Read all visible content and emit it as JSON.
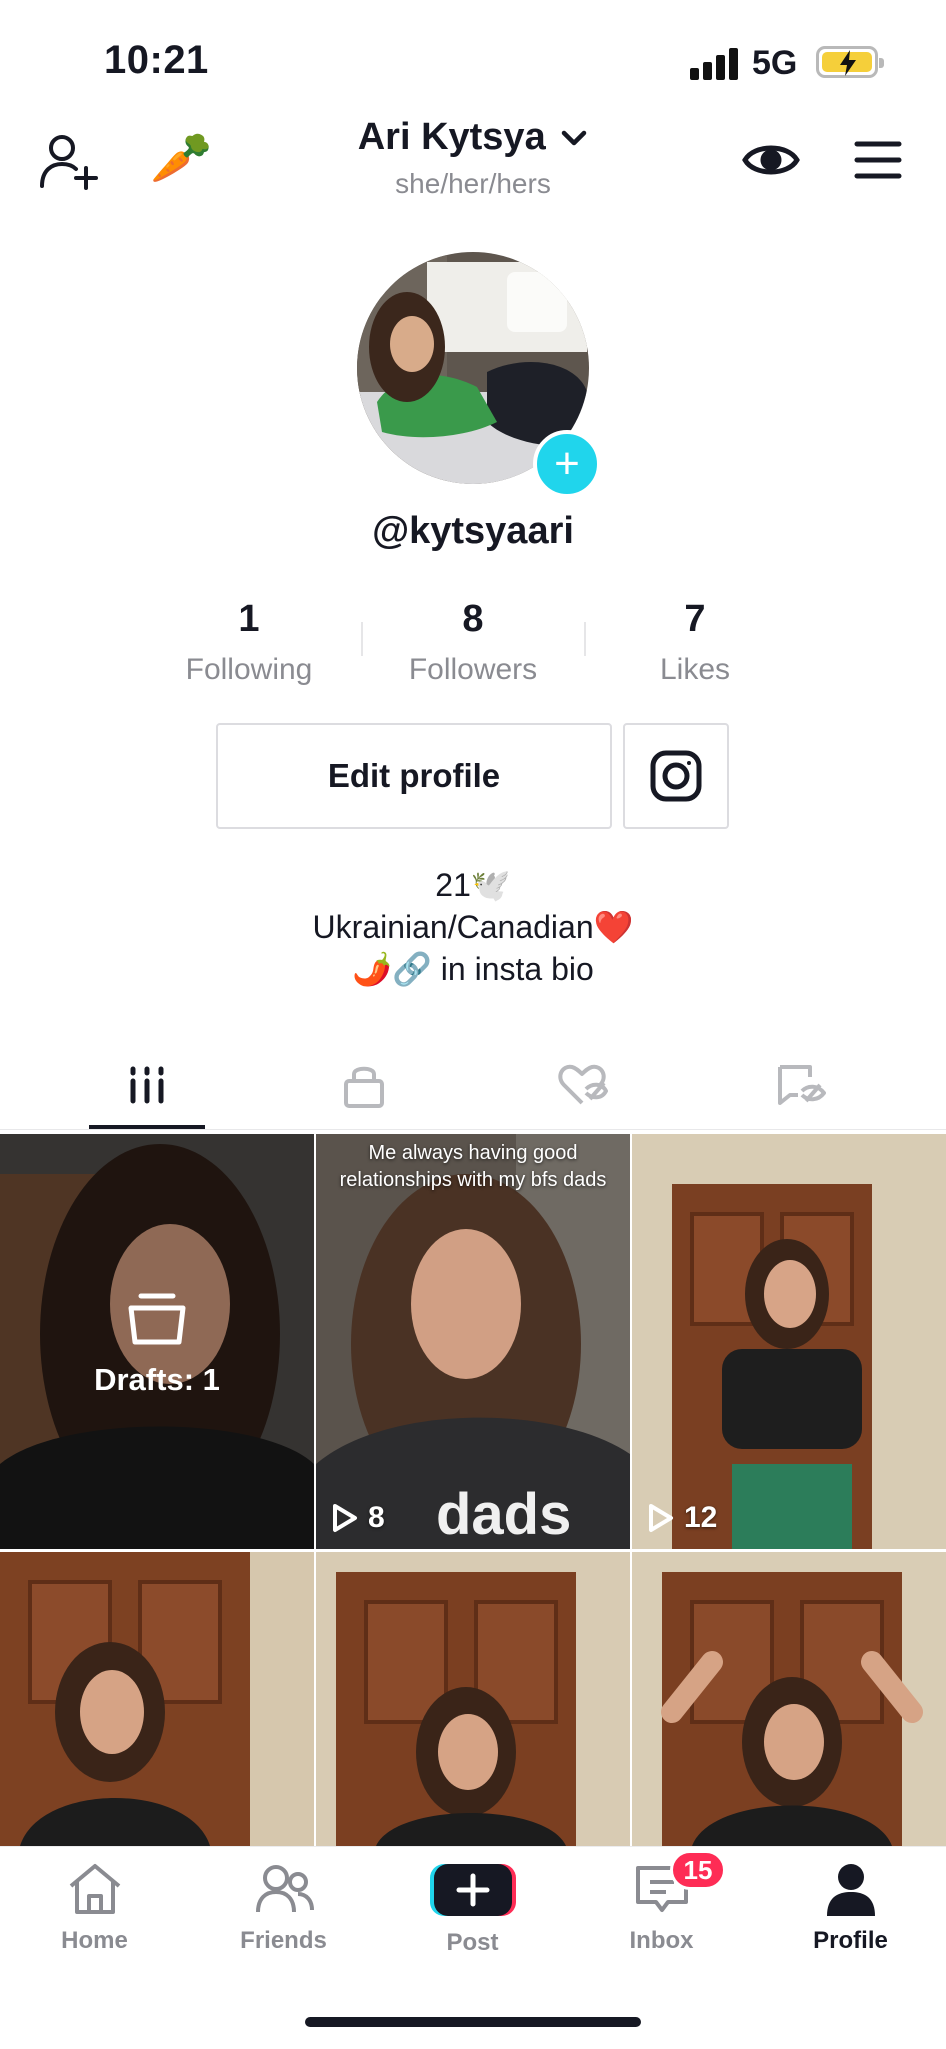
{
  "status_bar": {
    "time": "10:21",
    "network": "5G"
  },
  "header": {
    "display_name": "Ari Kytsya",
    "pronouns": "she/her/hers",
    "carrot_emoji": "🥕"
  },
  "profile": {
    "username": "@kytsyaari",
    "stats": [
      {
        "value": "1",
        "label": "Following"
      },
      {
        "value": "8",
        "label": "Followers"
      },
      {
        "value": "7",
        "label": "Likes"
      }
    ],
    "edit_label": "Edit profile",
    "bio": [
      "21🕊️",
      "Ukrainian/Canadian❤️",
      "🌶️🔗 in insta bio"
    ]
  },
  "tabs": [
    "videos-grid",
    "private-lock",
    "liked-heart",
    "hidden-favorites"
  ],
  "grid": {
    "drafts_label": "Drafts: 1",
    "tiles": [
      {
        "caption": "",
        "views": ""
      },
      {
        "caption": "Me always having good relationships with my bfs dads",
        "views": "8"
      },
      {
        "caption": "",
        "views": "12"
      },
      {
        "caption": "",
        "views": ""
      },
      {
        "caption": "",
        "views": ""
      },
      {
        "caption": "",
        "views": ""
      }
    ]
  },
  "nav": {
    "items": [
      {
        "label": "Home"
      },
      {
        "label": "Friends"
      },
      {
        "label": "Post"
      },
      {
        "label": "Inbox"
      },
      {
        "label": "Profile"
      }
    ],
    "inbox_badge": "15"
  },
  "colors": {
    "accent_pink": "#fe2c55",
    "accent_cyan": "#20d5ec",
    "text": "#161823",
    "muted": "#8a8b91"
  }
}
